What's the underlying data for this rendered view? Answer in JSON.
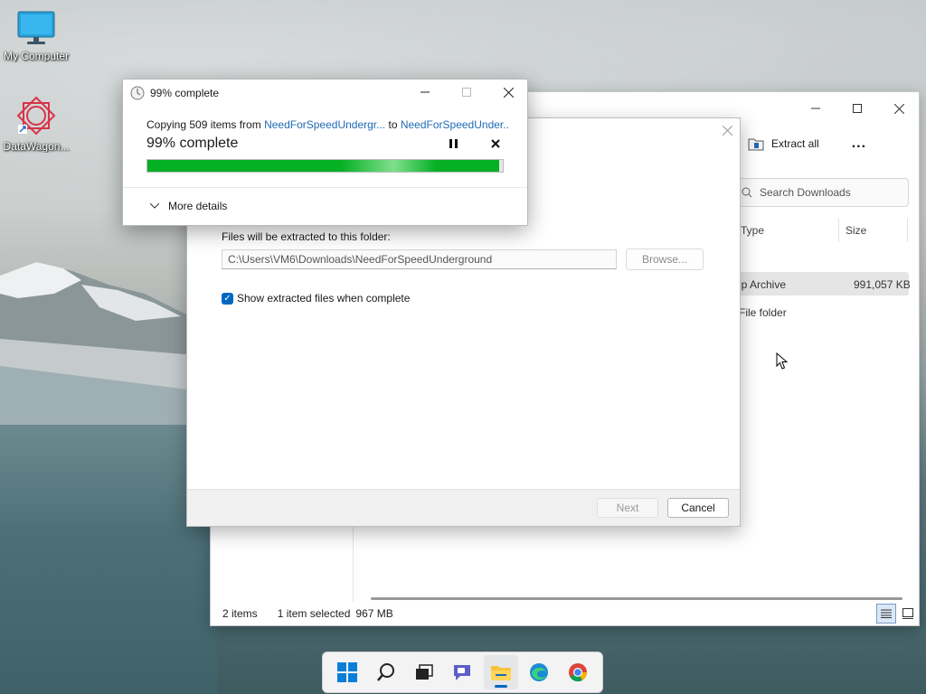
{
  "desktop": {
    "icons": [
      {
        "label": "My Computer"
      },
      {
        "label": "DataWagon..."
      }
    ]
  },
  "explorer": {
    "extract_all_label": "Extract all",
    "more_label": "...",
    "search_placeholder": "Search Downloads",
    "columns": {
      "type": "Type",
      "size": "Size"
    },
    "rows": [
      {
        "type": "ip Archive",
        "size": "991,057 KB"
      },
      {
        "type": "File folder",
        "size": ""
      }
    ],
    "status": {
      "count": "2 items",
      "selected": "1 item selected",
      "size": "967 MB"
    }
  },
  "wizard": {
    "folder_label": "Files will be extracted to this folder:",
    "path_value": "C:\\Users\\VM6\\Downloads\\NeedForSpeedUnderground",
    "browse_label": "Browse...",
    "show_files_label": "Show extracted files when complete",
    "next_label": "Next",
    "cancel_label": "Cancel"
  },
  "progress_dialog": {
    "title": "99% complete",
    "copy_prefix": "Copying 509 items from ",
    "source": "NeedForSpeedUndergr...",
    "to_word": " to ",
    "destination": "NeedForSpeedUnder...",
    "status_big": "99% complete",
    "progress": 0.99,
    "more_details_label": "More details"
  },
  "colors": {
    "accent": "#0067c0",
    "progress_green": "#06b025",
    "link": "#1f6ab5"
  }
}
